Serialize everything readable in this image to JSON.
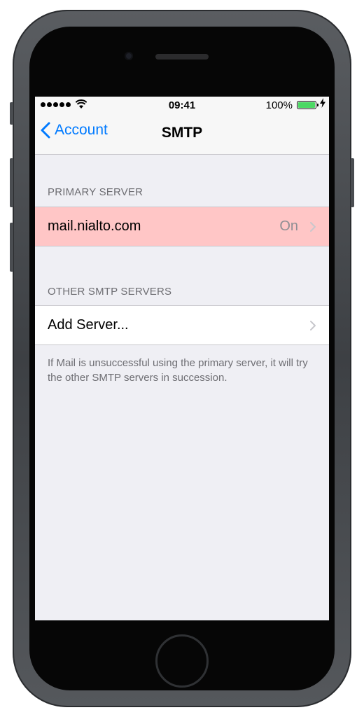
{
  "status_bar": {
    "time": "09:41",
    "battery_percent": "100%",
    "battery_level": 1.0,
    "signal_icon": "signal-dots-icon",
    "wifi_icon": "wifi-icon",
    "charging_icon": "bolt-icon"
  },
  "nav": {
    "back_label": "Account",
    "back_icon": "chevron-left-icon",
    "title": "SMTP"
  },
  "primary_section": {
    "header": "PRIMARY SERVER",
    "server_name": "mail.nialto.com",
    "status": "On",
    "highlight_color": "#ffc6c6"
  },
  "other_section": {
    "header": "OTHER SMTP SERVERS",
    "add_label": "Add Server..."
  },
  "footer": {
    "note": "If Mail is unsuccessful using the primary server, it will try the other SMTP servers in succession."
  },
  "colors": {
    "accent": "#007aff",
    "background": "#efeff4",
    "battery": "#4cd964"
  }
}
